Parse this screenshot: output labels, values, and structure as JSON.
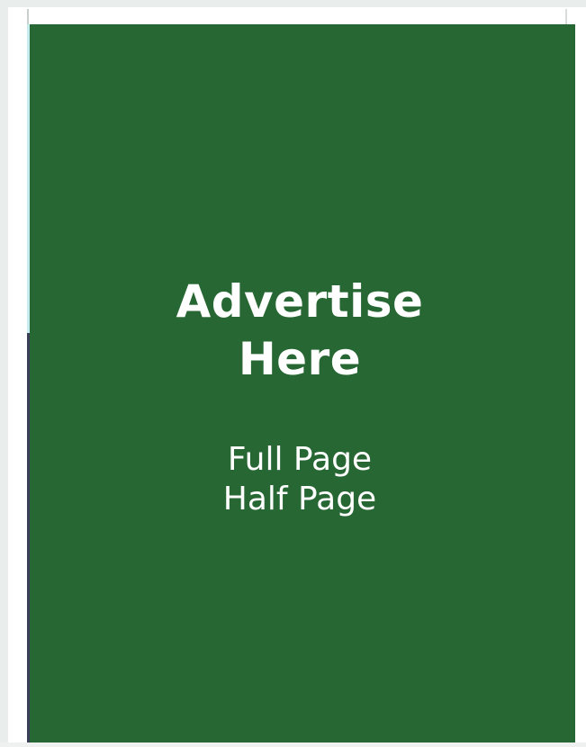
{
  "ad": {
    "title_line1": "Advertise",
    "title_line2": "Here",
    "options": [
      "Full Page",
      "Half Page"
    ]
  },
  "colors": {
    "panel": "#276733",
    "text": "#ffffff",
    "background": "#e9eeec"
  }
}
